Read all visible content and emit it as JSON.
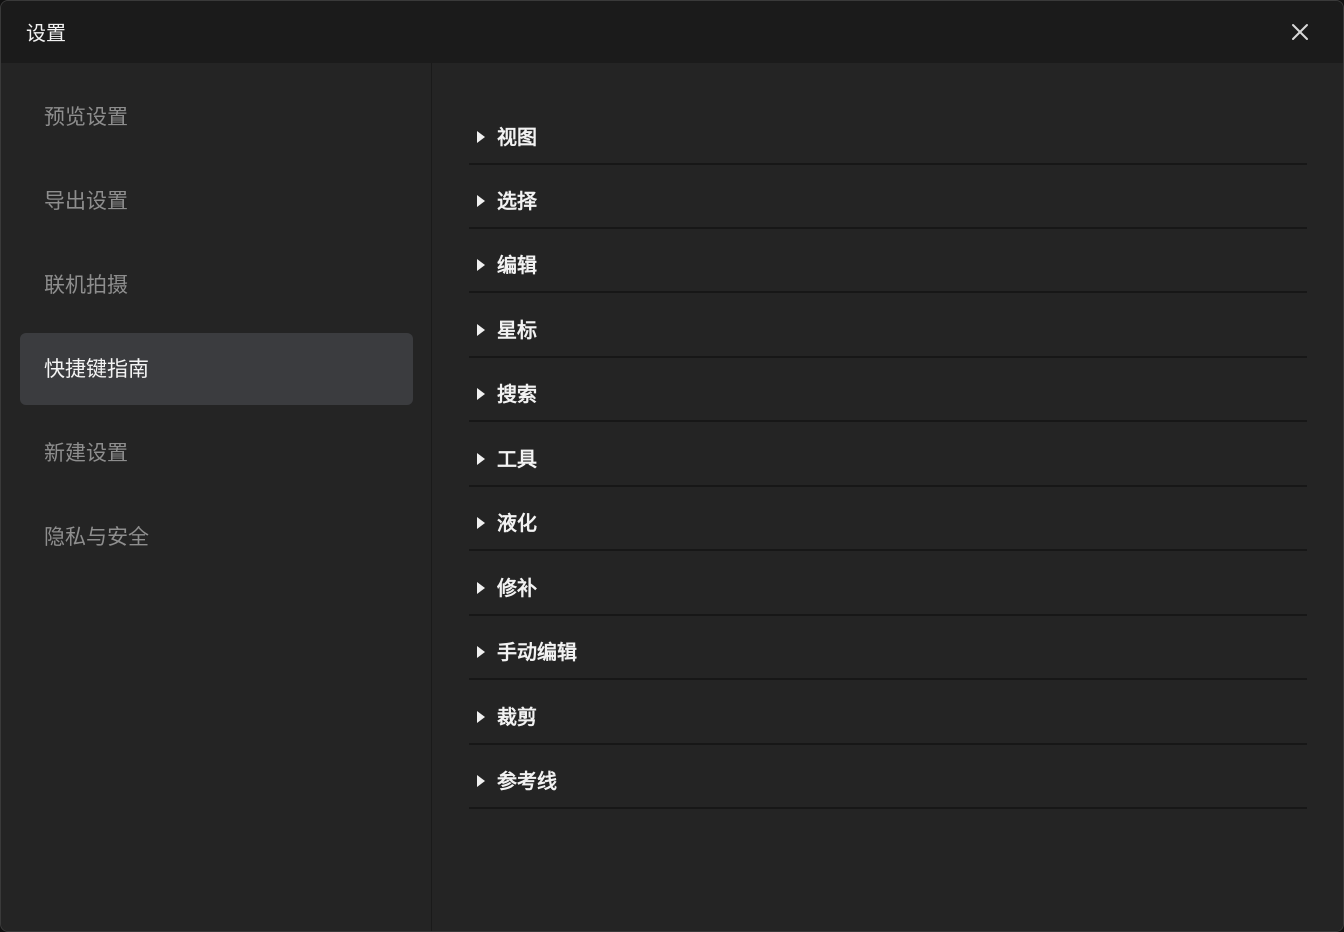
{
  "window": {
    "title": "设置",
    "close_icon": "close-icon"
  },
  "sidebar": {
    "items": [
      {
        "label": "预览设置",
        "active": false
      },
      {
        "label": "导出设置",
        "active": false
      },
      {
        "label": "联机拍摄",
        "active": false
      },
      {
        "label": "快捷键指南",
        "active": true
      },
      {
        "label": "新建设置",
        "active": false
      },
      {
        "label": "隐私与安全",
        "active": false
      }
    ]
  },
  "main": {
    "sections": [
      {
        "label": "视图",
        "icon": "caret-right-icon"
      },
      {
        "label": "选择",
        "icon": "caret-right-icon"
      },
      {
        "label": "编辑",
        "icon": "caret-right-icon"
      },
      {
        "label": "星标",
        "icon": "caret-right-icon"
      },
      {
        "label": "搜索",
        "icon": "caret-right-icon"
      },
      {
        "label": "工具",
        "icon": "caret-right-icon"
      },
      {
        "label": "液化",
        "icon": "caret-right-icon"
      },
      {
        "label": "修补",
        "icon": "caret-right-icon"
      },
      {
        "label": "手动编辑",
        "icon": "caret-right-icon"
      },
      {
        "label": "裁剪",
        "icon": "caret-right-icon"
      },
      {
        "label": "参考线",
        "icon": "caret-right-icon"
      }
    ]
  },
  "colors": {
    "background": "#232323",
    "titlebar": "#1b1b1b",
    "active_item": "#3b3c3f",
    "text_primary": "#f2f2f2",
    "text_muted": "#8e8e8e"
  }
}
